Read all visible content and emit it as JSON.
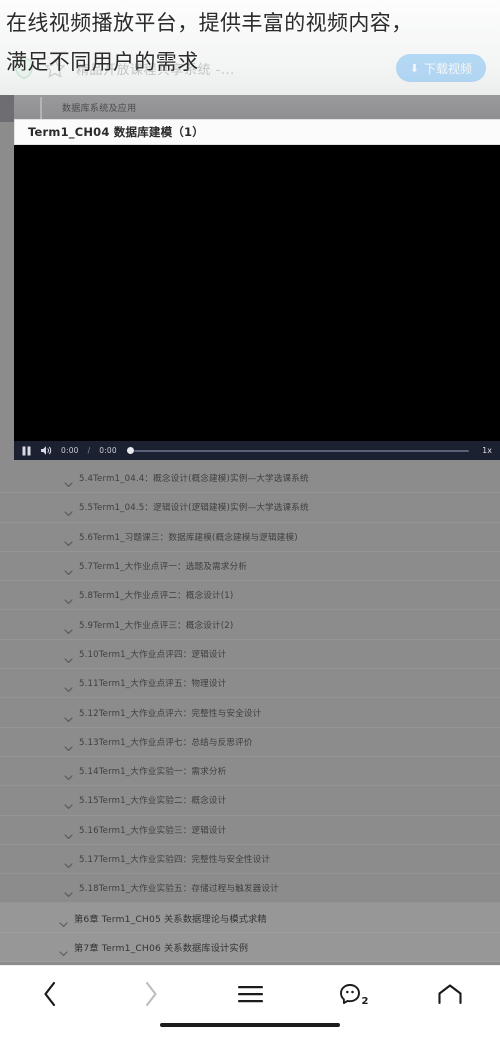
{
  "promo": {
    "line1": "在线视频播放平台，提供丰富的视频内容，",
    "line2": "满足不同用户的需求"
  },
  "banner": {
    "shield_icon": "shield-icon",
    "star_icon": "star-icon",
    "site_title": "精品开放课程共享系统 -...",
    "download_icon": "download-icon",
    "download_label": "下载视频",
    "accent_color": "#2196f3"
  },
  "page": {
    "breadcrumb": "数据库系统及应用",
    "video_title": "Term1_CH04 数据库建模（1）"
  },
  "player": {
    "pause_icon": "pause-icon",
    "volume_icon": "volume-icon",
    "current_time": "0:00",
    "time_separator": "/",
    "duration": "0:00",
    "speed_label": "1x"
  },
  "lessons": [
    {
      "icon": "chevron-down-icon",
      "label": "5.4Term1_04.4：概念设计(概念建模)实例—大学选课系统",
      "type": "lesson"
    },
    {
      "icon": "chevron-down-icon",
      "label": "5.5Term1_04.5：逻辑设计(逻辑建模)实例—大学选课系统",
      "type": "lesson"
    },
    {
      "icon": "chevron-down-icon",
      "label": "5.6Term1_习题课三：数据库建模(概念建模与逻辑建模)",
      "type": "lesson"
    },
    {
      "icon": "chevron-down-icon",
      "label": "5.7Term1_大作业点评一：选题及需求分析",
      "type": "lesson"
    },
    {
      "icon": "chevron-down-icon",
      "label": "5.8Term1_大作业点评二：概念设计(1)",
      "type": "lesson"
    },
    {
      "icon": "chevron-down-icon",
      "label": "5.9Term1_大作业点评三：概念设计(2)",
      "type": "lesson"
    },
    {
      "icon": "chevron-down-icon",
      "label": "5.10Term1_大作业点评四：逻辑设计",
      "type": "lesson"
    },
    {
      "icon": "chevron-down-icon",
      "label": "5.11Term1_大作业点评五：物理设计",
      "type": "lesson"
    },
    {
      "icon": "chevron-down-icon",
      "label": "5.12Term1_大作业点评六：完整性与安全设计",
      "type": "lesson"
    },
    {
      "icon": "chevron-down-icon",
      "label": "5.13Term1_大作业点评七：总结与反思评价",
      "type": "lesson"
    },
    {
      "icon": "chevron-down-icon",
      "label": "5.14Term1_大作业实验一：需求分析",
      "type": "lesson"
    },
    {
      "icon": "chevron-down-icon",
      "label": "5.15Term1_大作业实验二：概念设计",
      "type": "lesson"
    },
    {
      "icon": "chevron-down-icon",
      "label": "5.16Term1_大作业实验三：逻辑设计",
      "type": "lesson"
    },
    {
      "icon": "chevron-down-icon",
      "label": "5.17Term1_大作业实验四：完整性与安全性设计",
      "type": "lesson"
    },
    {
      "icon": "chevron-down-icon",
      "label": "5.18Term1_大作业实验五：存储过程与触发器设计",
      "type": "lesson"
    },
    {
      "icon": "chevron-down-icon",
      "label": "第6章 Term1_CH05 关系数据理论与模式求精",
      "type": "chapter"
    },
    {
      "icon": "chevron-down-icon",
      "label": "第7章 Term1_CH06 关系数据库设计实例",
      "type": "chapter"
    }
  ],
  "navbar": {
    "back_icon": "chevron-left-icon",
    "forward_icon": "chevron-right-icon",
    "menu_icon": "hamburger-menu-icon",
    "tabs_icon": "tabs-icon",
    "tabs_count": "2",
    "home_icon": "home-icon"
  }
}
